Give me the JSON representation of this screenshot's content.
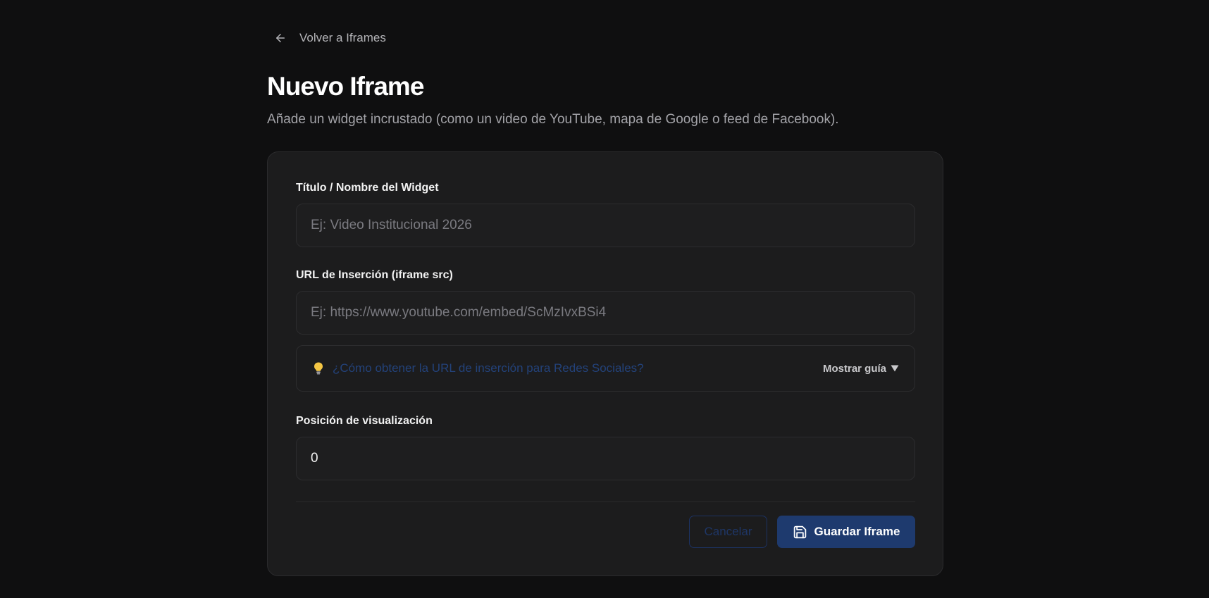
{
  "nav": {
    "back_label": "Volver a Iframes"
  },
  "header": {
    "title": "Nuevo Iframe",
    "subtitle": "Añade un widget incrustado (como un video de YouTube, mapa de Google o feed de Facebook)."
  },
  "form": {
    "title_field": {
      "label": "Título / Nombre del Widget",
      "placeholder": "Ej: Video Institucional 2026",
      "value": ""
    },
    "url_field": {
      "label": "URL de Inserción (iframe src)",
      "placeholder": "Ej: https://www.youtube.com/embed/ScMzIvxBSi4",
      "value": ""
    },
    "guide": {
      "question": "¿Cómo obtener la URL de inserción para Redes Sociales?",
      "toggle_label": "Mostrar guía"
    },
    "position_field": {
      "label": "Posición de visualización",
      "value": "0"
    },
    "actions": {
      "cancel_label": "Cancelar",
      "save_label": "Guardar Iframe"
    }
  },
  "icons": {
    "back": "arrow-left-icon",
    "tip": "lightbulb-icon",
    "toggle": "caret-down-icon",
    "save": "floppy-disk-icon"
  },
  "colors": {
    "background": "#0f0f10",
    "card": "#1c1c1d",
    "accent": "#1e3a6e",
    "link": "#23427a"
  }
}
